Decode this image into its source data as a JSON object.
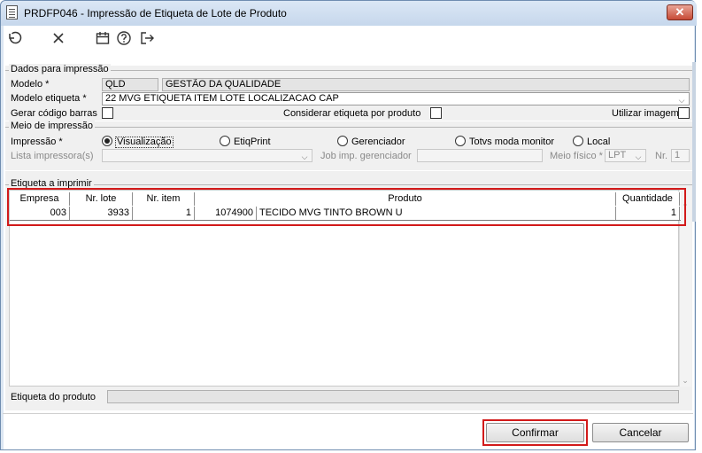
{
  "window": {
    "title": "PRDFP046 - Impressão de Etiqueta de Lote de Produto",
    "close_label": "✕"
  },
  "toolbar": {
    "icons": [
      "undo-icon",
      "close-icon",
      "calendar-icon",
      "help-icon",
      "exit-icon"
    ]
  },
  "dados": {
    "legend": "Dados para impressão",
    "modelo_label": "Modelo *",
    "modelo_code": "QLD",
    "modelo_name": "GESTÃO DA QUALIDADE",
    "modelo_etiqueta_label": "Modelo etiqueta *",
    "modelo_etiqueta_value": "22 MVG ETIQUETA ITEM LOTE LOCALIZACAO CAP",
    "gerar_codigo_label": "Gerar código barras",
    "considerar_label": "Considerar etiqueta por produto",
    "utilizar_imagem_label": "Utilizar imagem"
  },
  "meio": {
    "legend": "Meio de impressão",
    "impressao_label": "Impressão *",
    "options": [
      "Visualização",
      "EtiqPrint",
      "Gerenciador",
      "Totvs moda monitor",
      "Local"
    ],
    "selected": "Visualização",
    "lista_label": "Lista impressora(s)",
    "job_label": "Job imp. gerenciador",
    "meio_fisico_label": "Meio físico *",
    "meio_fisico_value": "LPT",
    "nr_label": "Nr.",
    "nr_value": "1"
  },
  "etiqueta": {
    "legend": "Etiqueta a imprimir",
    "columns": [
      "Empresa",
      "Nr. lote",
      "Nr. item",
      "Produto",
      "Quantidade"
    ],
    "rows": [
      {
        "empresa": "003",
        "lote": "3933",
        "item": "1",
        "produto_cod": "1074900",
        "produto_desc": "TECIDO MVG TINTO BROWN U",
        "quantidade": "1"
      }
    ],
    "etiqueta_produto_label": "Etiqueta do produto"
  },
  "buttons": {
    "confirmar": "Confirmar",
    "cancelar": "Cancelar"
  },
  "colors": {
    "highlight": "#d21a1a",
    "panel": "#f0f0f0",
    "titlebar": "#c6d7ec"
  }
}
